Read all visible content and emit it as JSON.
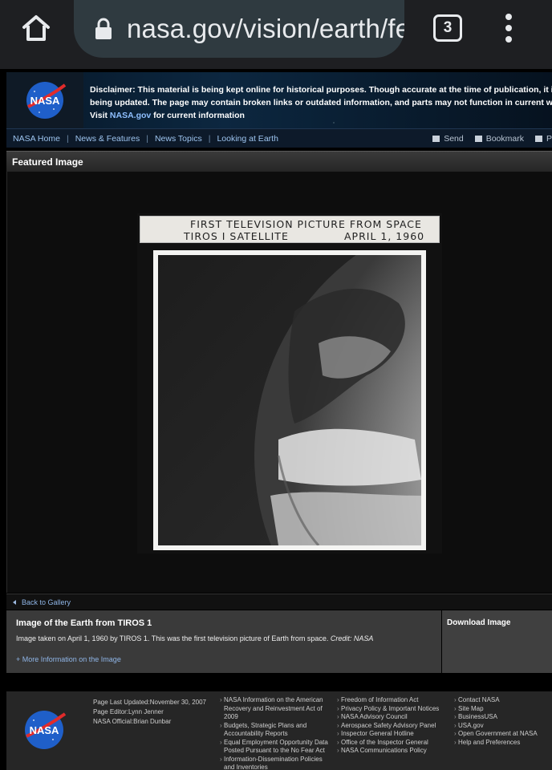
{
  "browser": {
    "url": "nasa.gov/vision/earth/fe",
    "tab_count": "3",
    "icons": [
      "home-icon",
      "lock-icon",
      "tabs-icon",
      "overflow-menu-icon"
    ]
  },
  "header": {
    "logo_text": "NASA",
    "disclaimer_line1": "Disclaimer: This material is being kept online for historical purposes. Though accurate at the time of publication, it is no long",
    "disclaimer_line2": "being updated. The page may contain broken links or outdated information, and parts may not function in current web brows",
    "disclaimer_visit": "Visit ",
    "disclaimer_link": "NASA.gov",
    "disclaimer_tail": " for current information"
  },
  "nav": {
    "items": [
      "NASA Home",
      "News & Features",
      "News Topics",
      "Looking at Earth"
    ],
    "send": "Send",
    "bookmark": "Bookmark",
    "print_partial": "P"
  },
  "featured": {
    "title": "Featured Image",
    "photo_caption_line1": "FIRST TELEVISION PICTURE FROM SPACE",
    "photo_caption_left": "TIROS I SATELLITE",
    "photo_caption_right": "APRIL 1, 1960",
    "back_link": "Back to Gallery"
  },
  "info": {
    "title": "Image of the Earth from TIROS 1",
    "description": "Image taken on April 1, 1960 by TIROS 1. This was the first television picture of Earth from space. ",
    "credit": "Credit: NASA",
    "more_link": "+ More Information on the Image",
    "download": "Download Image"
  },
  "footer": {
    "logo_text": "NASA",
    "updated": "Page Last Updated:November 30, 2007",
    "editor": "Page Editor:Lynn Jenner",
    "official": "NASA Official:Brian Dunbar",
    "col1": [
      "NASA Information on the American Recovery and Reinvestment Act of 2009",
      "Budgets, Strategic Plans and Accountability Reports",
      "Equal Employment Opportunity Data Posted Pursuant to the No Fear Act",
      "Information-Dissemination Policies and Inventories"
    ],
    "col2": [
      "Freedom of Information Act",
      "Privacy Policy & Important Notices",
      "NASA Advisory Council",
      "Aerospace Safety Advisory Panel",
      "Inspector General Hotline",
      "Office of the Inspector General",
      "NASA Communications Policy"
    ],
    "col3": [
      "Contact NASA",
      "Site Map",
      "BusinessUSA",
      "USA.gov",
      "Open Government at NASA",
      "Help and Preferences"
    ]
  }
}
